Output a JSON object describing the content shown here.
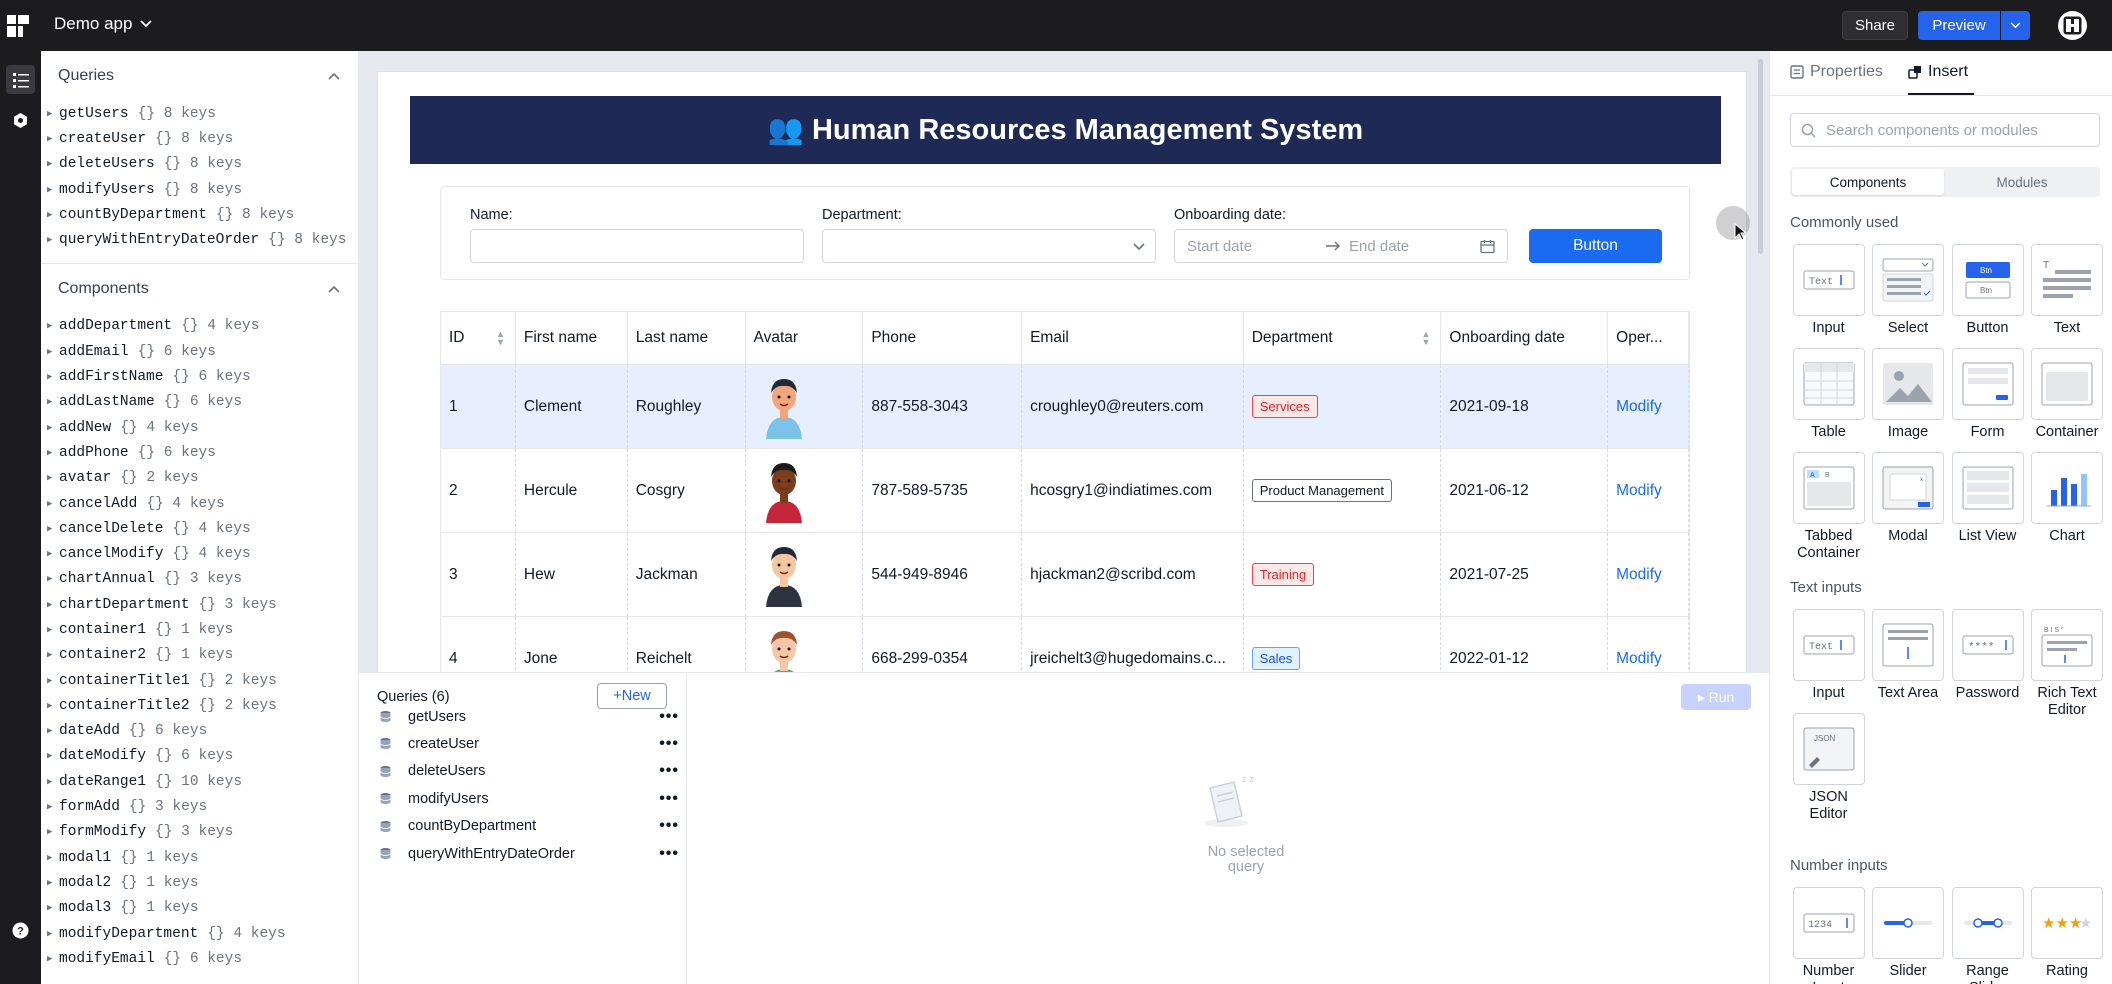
{
  "app": {
    "name": "Demo app"
  },
  "topbar": {
    "share": "Share",
    "preview": "Preview"
  },
  "left": {
    "queries_title": "Queries",
    "queries": [
      {
        "name": "getUsers",
        "keys": "{} 8 keys"
      },
      {
        "name": "createUser",
        "keys": "{} 8 keys"
      },
      {
        "name": "deleteUsers",
        "keys": "{} 8 keys"
      },
      {
        "name": "modifyUsers",
        "keys": "{} 8 keys"
      },
      {
        "name": "countByDepartment",
        "keys": "{} 8 keys"
      },
      {
        "name": "queryWithEntryDateOrder",
        "keys": "{} 8 keys"
      }
    ],
    "components_title": "Components",
    "components": [
      {
        "name": "addDepartment",
        "keys": "{} 4 keys"
      },
      {
        "name": "addEmail",
        "keys": "{} 6 keys"
      },
      {
        "name": "addFirstName",
        "keys": "{} 6 keys"
      },
      {
        "name": "addLastName",
        "keys": "{} 6 keys"
      },
      {
        "name": "addNew",
        "keys": "{} 4 keys"
      },
      {
        "name": "addPhone",
        "keys": "{} 6 keys"
      },
      {
        "name": "avatar",
        "keys": "{} 2 keys"
      },
      {
        "name": "cancelAdd",
        "keys": "{} 4 keys"
      },
      {
        "name": "cancelDelete",
        "keys": "{} 4 keys"
      },
      {
        "name": "cancelModify",
        "keys": "{} 4 keys"
      },
      {
        "name": "chartAnnual",
        "keys": "{} 3 keys"
      },
      {
        "name": "chartDepartment",
        "keys": "{} 3 keys"
      },
      {
        "name": "container1",
        "keys": "{} 1 keys"
      },
      {
        "name": "container2",
        "keys": "{} 1 keys"
      },
      {
        "name": "containerTitle1",
        "keys": "{} 2 keys"
      },
      {
        "name": "containerTitle2",
        "keys": "{} 2 keys"
      },
      {
        "name": "dateAdd",
        "keys": "{} 6 keys"
      },
      {
        "name": "dateModify",
        "keys": "{} 6 keys"
      },
      {
        "name": "dateRange1",
        "keys": "{} 10 keys"
      },
      {
        "name": "formAdd",
        "keys": "{} 3 keys"
      },
      {
        "name": "formModify",
        "keys": "{} 3 keys"
      },
      {
        "name": "modal1",
        "keys": "{} 1 keys"
      },
      {
        "name": "modal2",
        "keys": "{} 1 keys"
      },
      {
        "name": "modal3",
        "keys": "{} 1 keys"
      },
      {
        "name": "modifyDepartment",
        "keys": "{} 4 keys"
      },
      {
        "name": "modifyEmail",
        "keys": "{} 6 keys"
      }
    ]
  },
  "hr": {
    "title": "👥 Human Resources Management System",
    "name_label": "Name:",
    "dept_label": "Department:",
    "date_label": "Onboarding date:",
    "start_ph": "Start date",
    "end_ph": "End date",
    "button": "Button",
    "headers": [
      "ID",
      "First name",
      "Last name",
      "Avatar",
      "Phone",
      "Email",
      "Department",
      "Onboarding date",
      "Oper..."
    ],
    "rows": [
      {
        "id": "1",
        "first": "Clement",
        "last": "Roughley",
        "phone": "887-558-3043",
        "email": "croughley0@reuters.com",
        "dept": "Services",
        "date": "2021-09-18",
        "op": "Modify"
      },
      {
        "id": "2",
        "first": "Hercule",
        "last": "Cosgry",
        "phone": "787-589-5735",
        "email": "hcosgry1@indiatimes.com",
        "dept": "Product Management",
        "date": "2021-06-12",
        "op": "Modify"
      },
      {
        "id": "3",
        "first": "Hew",
        "last": "Jackman",
        "phone": "544-949-8946",
        "email": "hjackman2@scribd.com",
        "dept": "Training",
        "date": "2021-07-25",
        "op": "Modify"
      },
      {
        "id": "4",
        "first": "Jone",
        "last": "Reichelt",
        "phone": "668-299-0354",
        "email": "jreichelt3@hugedomains.c...",
        "dept": "Sales",
        "date": "2022-01-12",
        "op": "Modify"
      }
    ]
  },
  "queries_panel": {
    "title": "Queries (6)",
    "new": "+New",
    "run": "▸ Run",
    "items": [
      "getUsers",
      "createUser",
      "deleteUsers",
      "modifyUsers",
      "countByDepartment",
      "queryWithEntryDateOrder"
    ],
    "empty_1": "No selected",
    "empty_2": "query"
  },
  "right": {
    "tab_properties": "Properties",
    "tab_insert": "Insert",
    "search_ph": "Search components or modules",
    "seg_components": "Components",
    "seg_modules": "Modules",
    "cat_common": "Commonly used",
    "common": [
      "Input",
      "Select",
      "Button",
      "Text",
      "Table",
      "Image",
      "Form",
      "Container",
      "Tabbed Container",
      "Modal",
      "List View",
      "Chart"
    ],
    "cat_text": "Text inputs",
    "text": [
      "Input",
      "Text Area",
      "Password",
      "Rich Text Editor",
      "JSON Editor"
    ],
    "cat_number": "Number inputs",
    "number": [
      "Number Input",
      "Slider",
      "Range Slider",
      "Rating"
    ]
  },
  "colors": {
    "accent": "#2563eb",
    "header_bg": "#1e2a55",
    "topbar": "#1c1c1f"
  }
}
